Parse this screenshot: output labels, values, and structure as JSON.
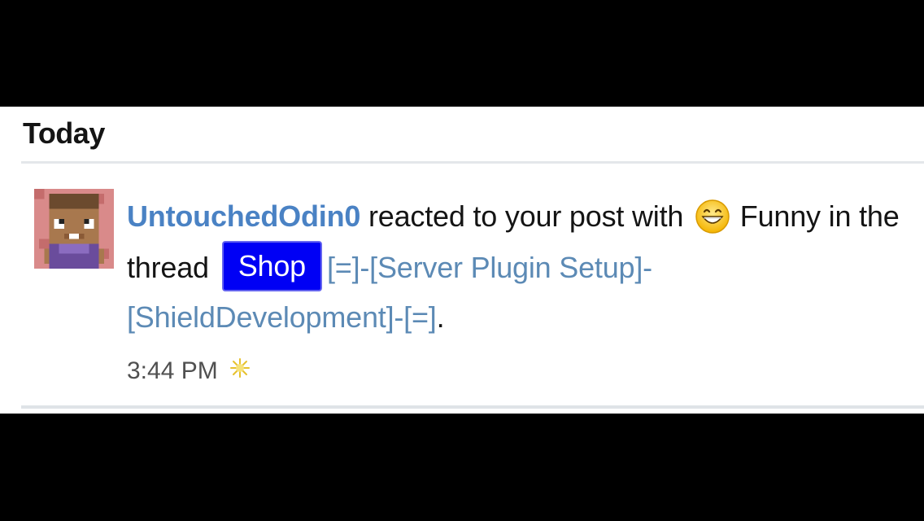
{
  "section": {
    "heading": "Today"
  },
  "alert": {
    "username": "UntouchedOdin0",
    "text_reacted": " reacted to your post with ",
    "reaction_icon": "grinning-face-icon",
    "reaction_label": " Funny",
    "text_in_thread": " in the thread ",
    "prefix": "Shop",
    "thread_title": "[=]-[Server Plugin Setup]-[ShieldDevelopment]-[=]",
    "end_punctuation": ".",
    "timestamp": "3:44 PM",
    "new_indicator_icon": "sparkle-icon"
  },
  "colors": {
    "username": "#4a82c4",
    "thread_link": "#5c8ab5",
    "prefix_badge": "#0000f5"
  }
}
